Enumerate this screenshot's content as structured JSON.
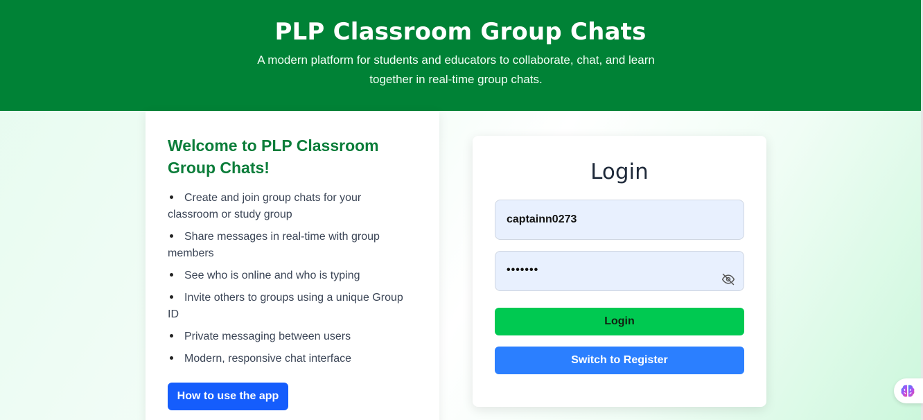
{
  "header": {
    "title": "PLP Classroom Group Chats",
    "subtitle": "A modern platform for students and educators to collaborate, chat, and learn together in real-time group chats."
  },
  "welcome": {
    "heading": "Welcome to PLP Classroom Group Chats!",
    "features": [
      "Create and join group chats for your classroom or study group",
      "Share messages in real-time with group members",
      "See who is online and who is typing",
      "Invite others to groups using a unique Group ID",
      "Private messaging between users",
      "Modern, responsive chat interface"
    ],
    "how_button": "How to use the app"
  },
  "login": {
    "title": "Login",
    "username_value": "captainn0273",
    "password_value": "•••••••",
    "login_button": "Login",
    "switch_button": "Switch to Register"
  },
  "icons": {
    "password_toggle": "eye-off-icon",
    "assistant": "brain-icon"
  },
  "colors": {
    "header_bg": "#008236",
    "welcome_heading": "#0c7d3a",
    "login_button": "#00c951",
    "register_button": "#2b7fff",
    "how_button": "#155dfc"
  }
}
